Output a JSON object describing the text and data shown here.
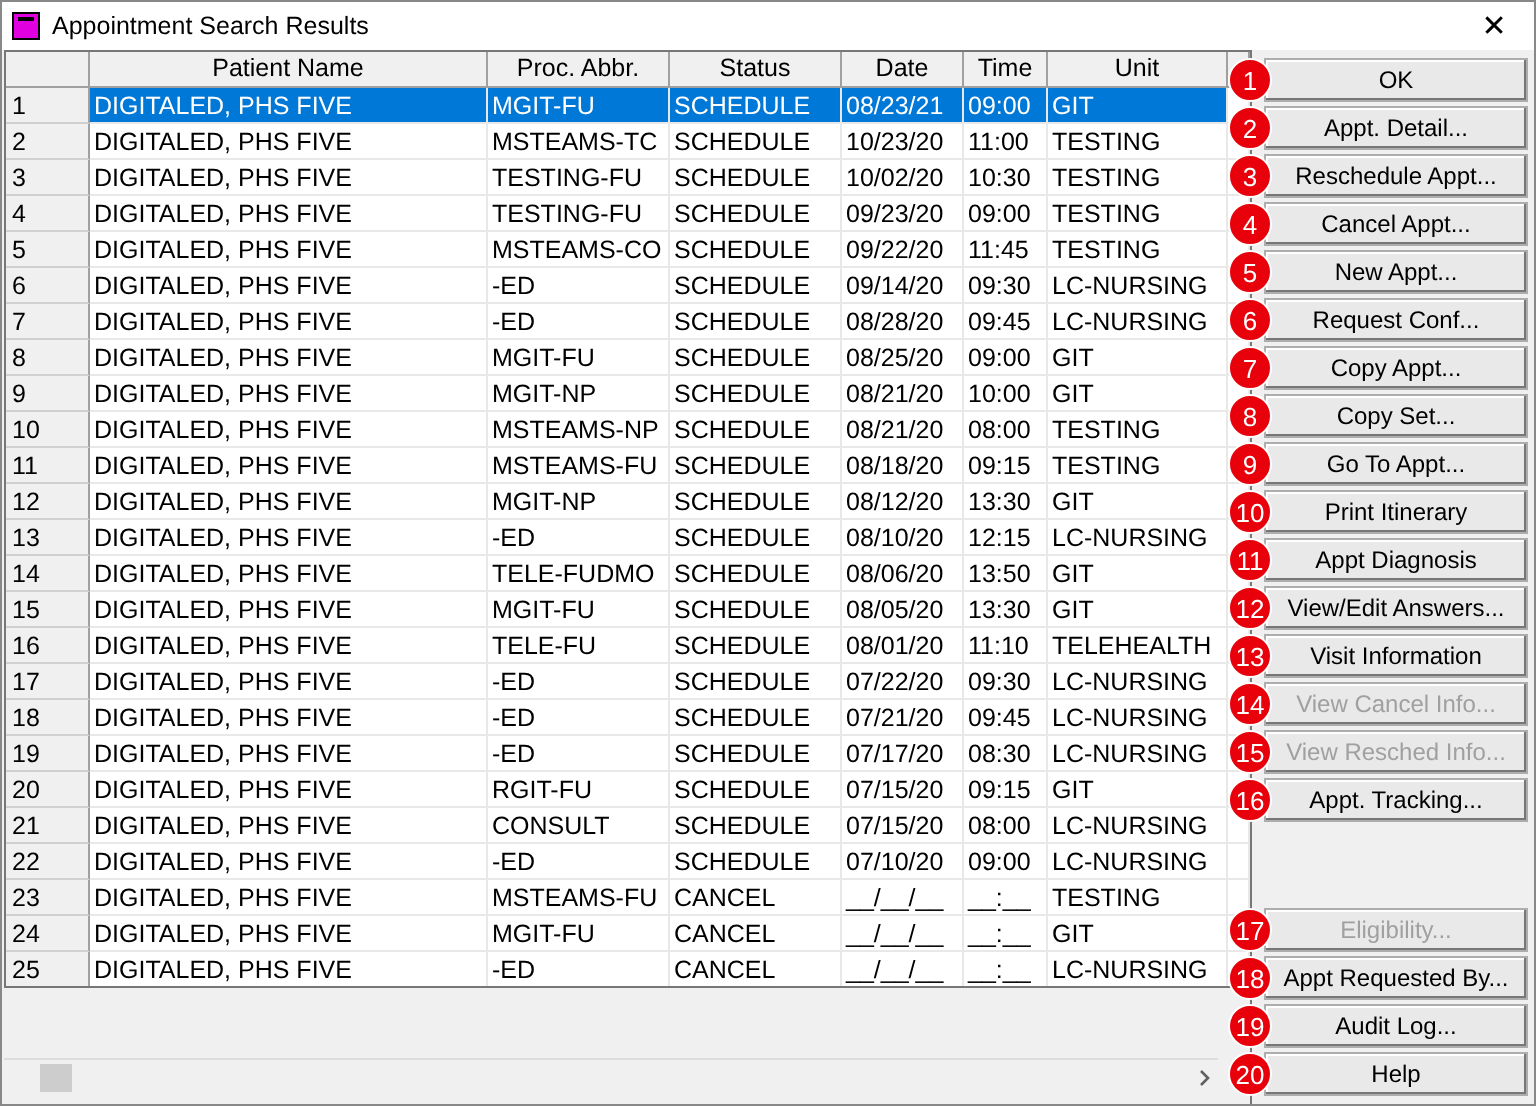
{
  "window": {
    "title": "Appointment Search Results",
    "close": "✕"
  },
  "table": {
    "columns": [
      "",
      "Patient Name",
      "Proc. Abbr.",
      "Status",
      "Date",
      "Time",
      "Unit"
    ],
    "rows": [
      {
        "selected": true,
        "cells": [
          "1",
          "DIGITALED, PHS FIVE",
          "MGIT-FU",
          "SCHEDULE",
          "08/23/21",
          "09:00",
          "GIT"
        ]
      },
      {
        "selected": false,
        "cells": [
          "2",
          "DIGITALED, PHS FIVE",
          "MSTEAMS-TC",
          "SCHEDULE",
          "10/23/20",
          "11:00",
          "TESTING"
        ]
      },
      {
        "selected": false,
        "cells": [
          "3",
          "DIGITALED, PHS FIVE",
          "TESTING-FU",
          "SCHEDULE",
          "10/02/20",
          "10:30",
          "TESTING"
        ]
      },
      {
        "selected": false,
        "cells": [
          "4",
          "DIGITALED, PHS FIVE",
          "TESTING-FU",
          "SCHEDULE",
          "09/23/20",
          "09:00",
          "TESTING"
        ]
      },
      {
        "selected": false,
        "cells": [
          "5",
          "DIGITALED, PHS FIVE",
          "MSTEAMS-CO",
          "SCHEDULE",
          "09/22/20",
          "11:45",
          "TESTING"
        ]
      },
      {
        "selected": false,
        "cells": [
          "6",
          "DIGITALED, PHS FIVE",
          "-ED",
          "SCHEDULE",
          "09/14/20",
          "09:30",
          "LC-NURSING"
        ]
      },
      {
        "selected": false,
        "cells": [
          "7",
          "DIGITALED, PHS FIVE",
          "-ED",
          "SCHEDULE",
          "08/28/20",
          "09:45",
          "LC-NURSING"
        ]
      },
      {
        "selected": false,
        "cells": [
          "8",
          "DIGITALED, PHS FIVE",
          "MGIT-FU",
          "SCHEDULE",
          "08/25/20",
          "09:00",
          "GIT"
        ]
      },
      {
        "selected": false,
        "cells": [
          "9",
          "DIGITALED, PHS FIVE",
          "MGIT-NP",
          "SCHEDULE",
          "08/21/20",
          "10:00",
          "GIT"
        ]
      },
      {
        "selected": false,
        "cells": [
          "10",
          "DIGITALED, PHS FIVE",
          "MSTEAMS-NP",
          "SCHEDULE",
          "08/21/20",
          "08:00",
          "TESTING"
        ]
      },
      {
        "selected": false,
        "cells": [
          "11",
          "DIGITALED, PHS FIVE",
          "MSTEAMS-FU",
          "SCHEDULE",
          "08/18/20",
          "09:15",
          "TESTING"
        ]
      },
      {
        "selected": false,
        "cells": [
          "12",
          "DIGITALED, PHS FIVE",
          "MGIT-NP",
          "SCHEDULE",
          "08/12/20",
          "13:30",
          "GIT"
        ]
      },
      {
        "selected": false,
        "cells": [
          "13",
          "DIGITALED, PHS FIVE",
          "-ED",
          "SCHEDULE",
          "08/10/20",
          "12:15",
          "LC-NURSING"
        ]
      },
      {
        "selected": false,
        "cells": [
          "14",
          "DIGITALED, PHS FIVE",
          "TELE-FUDMO",
          "SCHEDULE",
          "08/06/20",
          "13:50",
          "GIT"
        ]
      },
      {
        "selected": false,
        "cells": [
          "15",
          "DIGITALED, PHS FIVE",
          "MGIT-FU",
          "SCHEDULE",
          "08/05/20",
          "13:30",
          "GIT"
        ]
      },
      {
        "selected": false,
        "cells": [
          "16",
          "DIGITALED, PHS FIVE",
          "TELE-FU",
          "SCHEDULE",
          "08/01/20",
          "11:10",
          "TELEHEALTH"
        ]
      },
      {
        "selected": false,
        "cells": [
          "17",
          "DIGITALED, PHS FIVE",
          "-ED",
          "SCHEDULE",
          "07/22/20",
          "09:30",
          "LC-NURSING"
        ]
      },
      {
        "selected": false,
        "cells": [
          "18",
          "DIGITALED, PHS FIVE",
          "-ED",
          "SCHEDULE",
          "07/21/20",
          "09:45",
          "LC-NURSING"
        ]
      },
      {
        "selected": false,
        "cells": [
          "19",
          "DIGITALED, PHS FIVE",
          "-ED",
          "SCHEDULE",
          "07/17/20",
          "08:30",
          "LC-NURSING"
        ]
      },
      {
        "selected": false,
        "cells": [
          "20",
          "DIGITALED, PHS FIVE",
          "RGIT-FU",
          "SCHEDULE",
          "07/15/20",
          "09:15",
          "GIT"
        ]
      },
      {
        "selected": false,
        "cells": [
          "21",
          "DIGITALED, PHS FIVE",
          "CONSULT",
          "SCHEDULE",
          "07/15/20",
          "08:00",
          "LC-NURSING"
        ]
      },
      {
        "selected": false,
        "cells": [
          "22",
          "DIGITALED, PHS FIVE",
          "-ED",
          "SCHEDULE",
          "07/10/20",
          "09:00",
          "LC-NURSING"
        ]
      },
      {
        "selected": false,
        "cells": [
          "23",
          "DIGITALED, PHS FIVE",
          "MSTEAMS-FU",
          "CANCEL",
          "__/__/__",
          "__:__",
          "TESTING"
        ]
      },
      {
        "selected": false,
        "cells": [
          "24",
          "DIGITALED, PHS FIVE",
          "MGIT-FU",
          "CANCEL",
          "__/__/__",
          "__:__",
          "GIT"
        ]
      },
      {
        "selected": false,
        "cells": [
          "25",
          "DIGITALED, PHS FIVE",
          "-ED",
          "CANCEL",
          "__/__/__",
          "__:__",
          "LC-NURSING"
        ]
      }
    ]
  },
  "buttons": [
    {
      "badge": "1",
      "label": "OK",
      "disabled": false
    },
    {
      "badge": "2",
      "label": "Appt. Detail...",
      "disabled": false
    },
    {
      "badge": "3",
      "label": "Reschedule Appt...",
      "disabled": false
    },
    {
      "badge": "4",
      "label": "Cancel Appt...",
      "disabled": false
    },
    {
      "badge": "5",
      "label": "New Appt...",
      "disabled": false
    },
    {
      "badge": "6",
      "label": "Request Conf...",
      "disabled": false
    },
    {
      "badge": "7",
      "label": "Copy Appt...",
      "disabled": false
    },
    {
      "badge": "8",
      "label": "Copy Set...",
      "disabled": false
    },
    {
      "badge": "9",
      "label": "Go To Appt...",
      "disabled": false
    },
    {
      "badge": "10",
      "label": "Print Itinerary",
      "disabled": false
    },
    {
      "badge": "11",
      "label": "Appt Diagnosis",
      "disabled": false
    },
    {
      "badge": "12",
      "label": "View/Edit Answers...",
      "disabled": false
    },
    {
      "badge": "13",
      "label": "Visit Information",
      "disabled": false
    },
    {
      "badge": "14",
      "label": "View Cancel Info...",
      "disabled": true
    },
    {
      "badge": "15",
      "label": "View Resched Info...",
      "disabled": true
    },
    {
      "badge": "16",
      "label": "Appt. Tracking...",
      "disabled": false
    }
  ],
  "lower_buttons": [
    {
      "badge": "17",
      "label": "Eligibility...",
      "disabled": true
    },
    {
      "badge": "18",
      "label": "Appt Requested By...",
      "disabled": false
    },
    {
      "badge": "19",
      "label": "Audit Log...",
      "disabled": false
    },
    {
      "badge": "20",
      "label": "Help",
      "disabled": false
    }
  ]
}
